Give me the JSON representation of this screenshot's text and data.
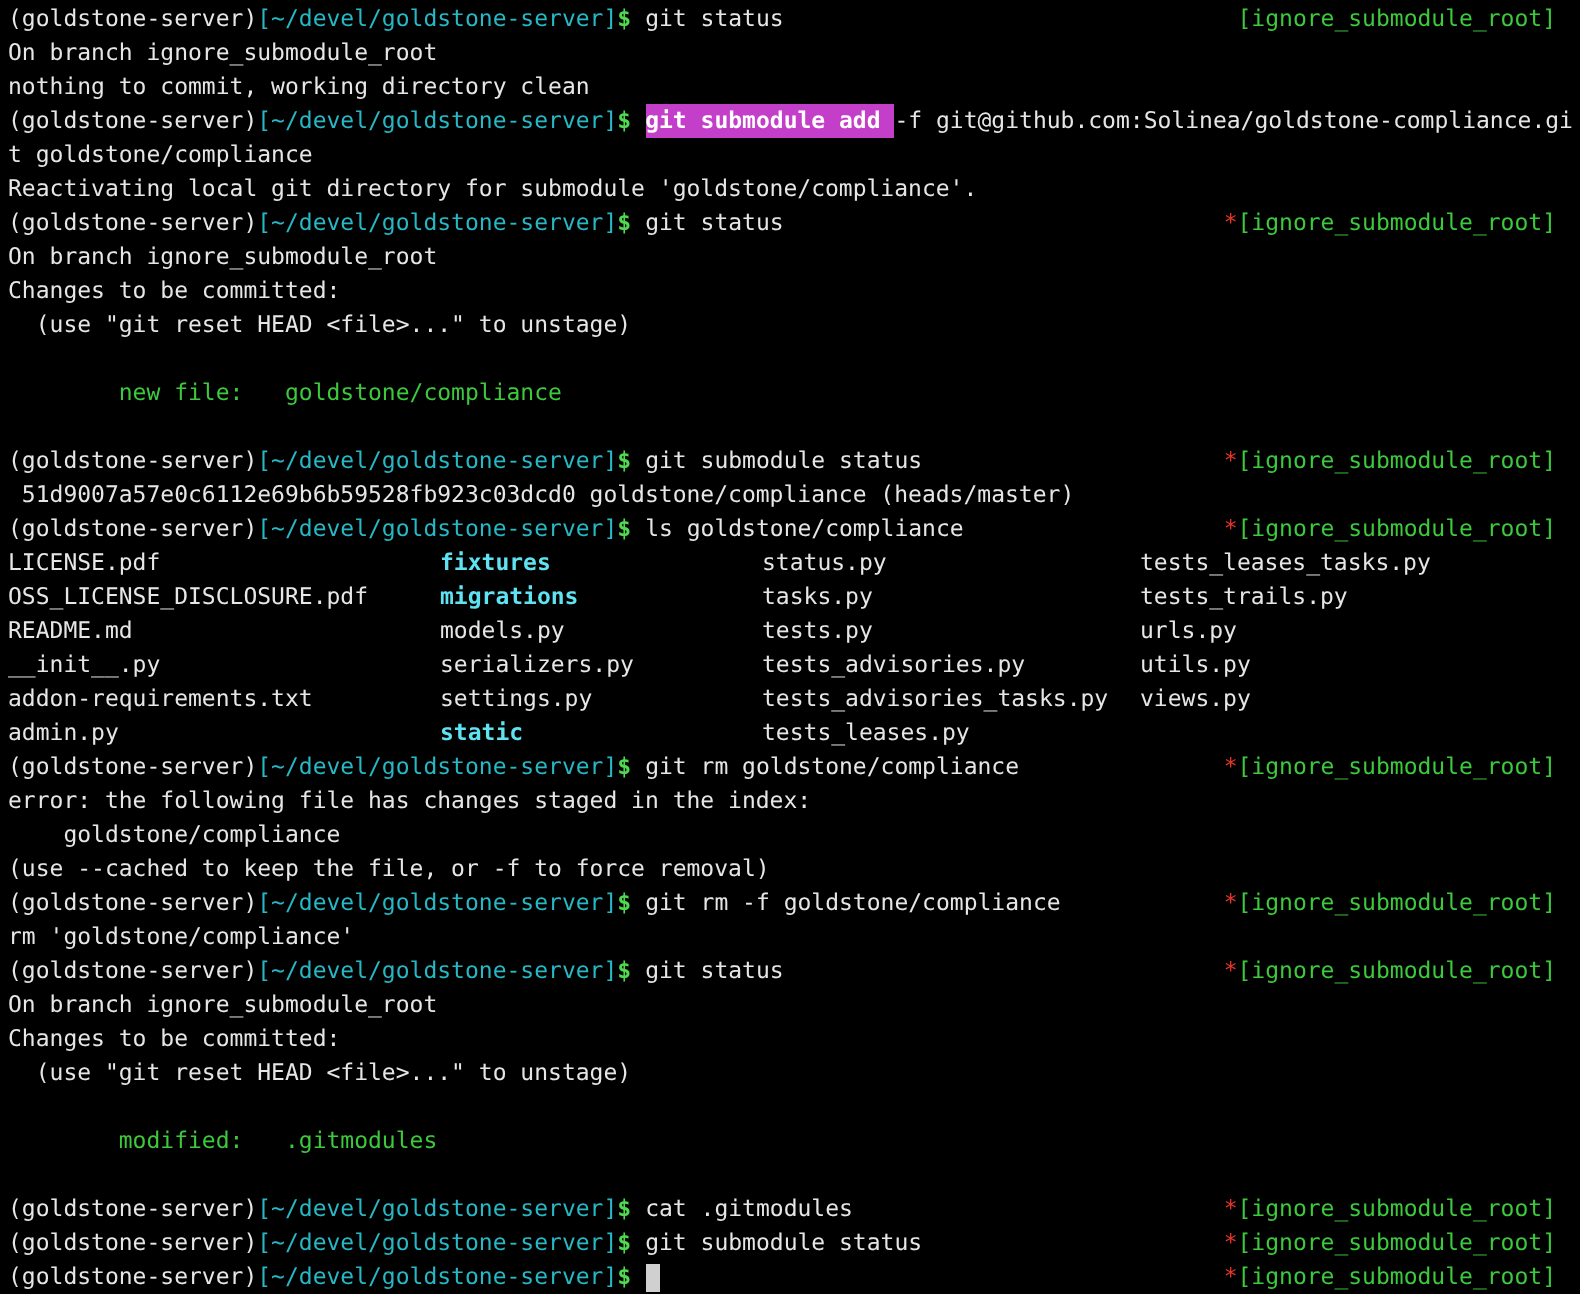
{
  "lines": [
    {
      "kind": "prompt",
      "env": "(goldstone-server)",
      "path": "[~/devel/goldstone-server]",
      "symbol": "$",
      "command": "git status",
      "branch": "[ignore_submodule_root]"
    },
    {
      "kind": "output",
      "text": "On branch ignore_submodule_root"
    },
    {
      "kind": "output",
      "text": "nothing to commit, working directory clean"
    },
    {
      "kind": "prompt",
      "env": "(goldstone-server)",
      "path": "[~/devel/goldstone-server]",
      "symbol": "$",
      "highlight": "git submodule add ",
      "command": "-f git@github.com:Solinea/goldstone-compliance.gi"
    },
    {
      "kind": "output",
      "text": "t goldstone/compliance"
    },
    {
      "kind": "output",
      "text": "Reactivating local git directory for submodule 'goldstone/compliance'."
    },
    {
      "kind": "prompt",
      "env": "(goldstone-server)",
      "path": "[~/devel/goldstone-server]",
      "symbol": "$",
      "command": "git status",
      "marker": "*",
      "branch": "[ignore_submodule_root]"
    },
    {
      "kind": "output",
      "text": "On branch ignore_submodule_root"
    },
    {
      "kind": "output",
      "text": "Changes to be committed:"
    },
    {
      "kind": "output",
      "text": "  (use \"git reset HEAD <file>...\" to unstage)"
    },
    {
      "kind": "blank"
    },
    {
      "kind": "staged",
      "text": "        new file:   goldstone/compliance"
    },
    {
      "kind": "blank"
    },
    {
      "kind": "prompt",
      "env": "(goldstone-server)",
      "path": "[~/devel/goldstone-server]",
      "symbol": "$",
      "command": "git submodule status",
      "marker": "*",
      "branch": "[ignore_submodule_root]"
    },
    {
      "kind": "output",
      "text": " 51d9007a57e0c6112e69b6b59528fb923c03dcd0 goldstone/compliance (heads/master)"
    },
    {
      "kind": "prompt",
      "env": "(goldstone-server)",
      "path": "[~/devel/goldstone-server]",
      "symbol": "$",
      "command": "ls goldstone/compliance",
      "marker": "*",
      "branch": "[ignore_submodule_root]"
    },
    {
      "kind": "listing",
      "cells": [
        {
          "text": "LICENSE.pdf",
          "directory": false
        },
        {
          "text": "fixtures",
          "directory": true
        },
        {
          "text": "status.py",
          "directory": false
        },
        {
          "text": "tests_leases_tasks.py",
          "directory": false
        }
      ]
    },
    {
      "kind": "listing",
      "cells": [
        {
          "text": "OSS_LICENSE_DISCLOSURE.pdf",
          "directory": false
        },
        {
          "text": "migrations",
          "directory": true
        },
        {
          "text": "tasks.py",
          "directory": false
        },
        {
          "text": "tests_trails.py",
          "directory": false
        }
      ]
    },
    {
      "kind": "listing",
      "cells": [
        {
          "text": "README.md",
          "directory": false
        },
        {
          "text": "models.py",
          "directory": false
        },
        {
          "text": "tests.py",
          "directory": false
        },
        {
          "text": "urls.py",
          "directory": false
        }
      ]
    },
    {
      "kind": "listing",
      "cells": [
        {
          "text": "__init__.py",
          "directory": false
        },
        {
          "text": "serializers.py",
          "directory": false
        },
        {
          "text": "tests_advisories.py",
          "directory": false
        },
        {
          "text": "utils.py",
          "directory": false
        }
      ]
    },
    {
      "kind": "listing",
      "cells": [
        {
          "text": "addon-requirements.txt",
          "directory": false
        },
        {
          "text": "settings.py",
          "directory": false
        },
        {
          "text": "tests_advisories_tasks.py",
          "directory": false
        },
        {
          "text": "views.py",
          "directory": false
        }
      ]
    },
    {
      "kind": "listing",
      "cells": [
        {
          "text": "admin.py",
          "directory": false
        },
        {
          "text": "static",
          "directory": true
        },
        {
          "text": "tests_leases.py",
          "directory": false
        }
      ]
    },
    {
      "kind": "prompt",
      "env": "(goldstone-server)",
      "path": "[~/devel/goldstone-server]",
      "symbol": "$",
      "command": "git rm goldstone/compliance",
      "marker": "*",
      "branch": "[ignore_submodule_root]"
    },
    {
      "kind": "output",
      "text": "error: the following file has changes staged in the index:"
    },
    {
      "kind": "output",
      "text": "    goldstone/compliance"
    },
    {
      "kind": "output",
      "text": "(use --cached to keep the file, or -f to force removal)"
    },
    {
      "kind": "prompt",
      "env": "(goldstone-server)",
      "path": "[~/devel/goldstone-server]",
      "symbol": "$",
      "command": "git rm -f goldstone/compliance",
      "marker": "*",
      "branch": "[ignore_submodule_root]"
    },
    {
      "kind": "output",
      "text": "rm 'goldstone/compliance'"
    },
    {
      "kind": "prompt",
      "env": "(goldstone-server)",
      "path": "[~/devel/goldstone-server]",
      "symbol": "$",
      "command": "git status",
      "marker": "*",
      "branch": "[ignore_submodule_root]"
    },
    {
      "kind": "output",
      "text": "On branch ignore_submodule_root"
    },
    {
      "kind": "output",
      "text": "Changes to be committed:"
    },
    {
      "kind": "output",
      "text": "  (use \"git reset HEAD <file>...\" to unstage)"
    },
    {
      "kind": "blank"
    },
    {
      "kind": "staged",
      "text": "        modified:   .gitmodules"
    },
    {
      "kind": "blank"
    },
    {
      "kind": "prompt",
      "env": "(goldstone-server)",
      "path": "[~/devel/goldstone-server]",
      "symbol": "$",
      "command": "cat .gitmodules",
      "marker": "*",
      "branch": "[ignore_submodule_root]"
    },
    {
      "kind": "prompt",
      "env": "(goldstone-server)",
      "path": "[~/devel/goldstone-server]",
      "symbol": "$",
      "command": "git submodule status",
      "marker": "*",
      "branch": "[ignore_submodule_root]"
    },
    {
      "kind": "prompt",
      "env": "(goldstone-server)",
      "path": "[~/devel/goldstone-server]",
      "symbol": "$",
      "cursor": true,
      "marker": "*",
      "branch": "[ignore_submodule_root]"
    }
  ]
}
